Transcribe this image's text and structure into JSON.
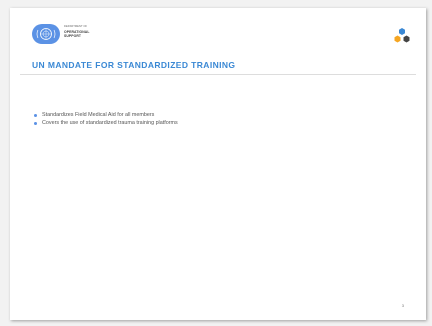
{
  "header": {
    "dept_line1": "DEPARTMENT OF",
    "dept_line2": "OPERATIONAL",
    "dept_line3": "SUPPORT"
  },
  "slide": {
    "title": "UN MANDATE FOR STANDARDIZED TRAINING",
    "bullets": [
      "Standardizes Field Medical Aid for all members",
      "Covers the use of standardized trauma training platforms"
    ],
    "page_number": "3"
  },
  "colors": {
    "title": "#3a88d4",
    "un_blue": "#5b92e5",
    "logo_orange": "#f5a623",
    "logo_blue": "#3a88d4",
    "logo_dark": "#444444"
  },
  "icons": {
    "un_logo": "un-emblem-icon",
    "corner_logo": "hexagon-cluster-icon",
    "bullet": "bullet-dot-icon"
  }
}
